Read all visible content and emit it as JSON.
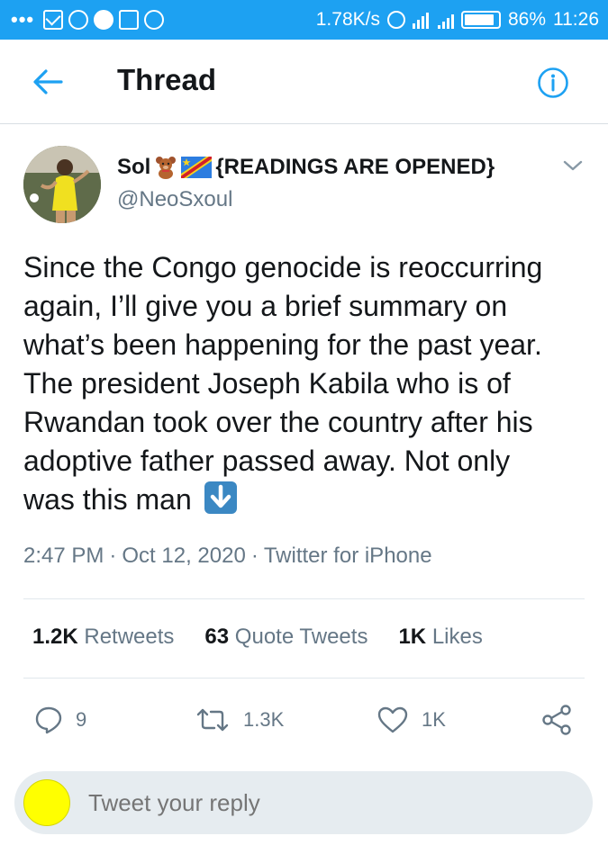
{
  "status_bar": {
    "network_speed": "1.78K/s",
    "battery_percent": "86%",
    "time": "11:26",
    "overflow_dots": "•••",
    "icons": [
      "mail-icon",
      "circle-icon",
      "vpn-icon",
      "gallery-icon",
      "sync-icon",
      "alarm-icon",
      "signal-icon",
      "battery-icon"
    ]
  },
  "header": {
    "title": "Thread",
    "back_icon": "arrow-left-icon",
    "info_icon": "info-icon"
  },
  "tweet": {
    "author_name": "Sol",
    "author_display_suffix": "{READINGS ARE OPENED}",
    "author_emojis": [
      "teddy-bear-emoji",
      "congo-flag-emoji"
    ],
    "handle": "@NeoSxoul",
    "text_lines": [
      "Since the Congo genocide is reoccurring",
      "again, I’ll give you a brief summary on",
      "what’s been happening for the past year.",
      "The president Joseph Kabila who is of",
      "Rwandan took over the country after his",
      "adoptive father passed away. Not only",
      "was this man"
    ],
    "trailing_emoji": "down-arrow-emoji",
    "time": "2:47 PM",
    "date": "Oct 12, 2020",
    "source": "Twitter for iPhone",
    "meta_separator": "·"
  },
  "stats": {
    "retweets_count": "1.2K",
    "retweets_label": "Retweets",
    "quotes_count": "63",
    "quotes_label": "Quote Tweets",
    "likes_count": "1K",
    "likes_label": "Likes"
  },
  "actions": {
    "reply_count": "9",
    "retweet_count": "1.3K",
    "like_count": "1K"
  },
  "reply": {
    "placeholder": "Tweet your reply"
  },
  "colors": {
    "brand": "#1da1f2",
    "text_primary": "#14171a",
    "text_secondary": "#657786",
    "divider": "#e1e8ed",
    "reply_bg": "#e6ecf0",
    "reply_avatar": "#ffff00"
  }
}
